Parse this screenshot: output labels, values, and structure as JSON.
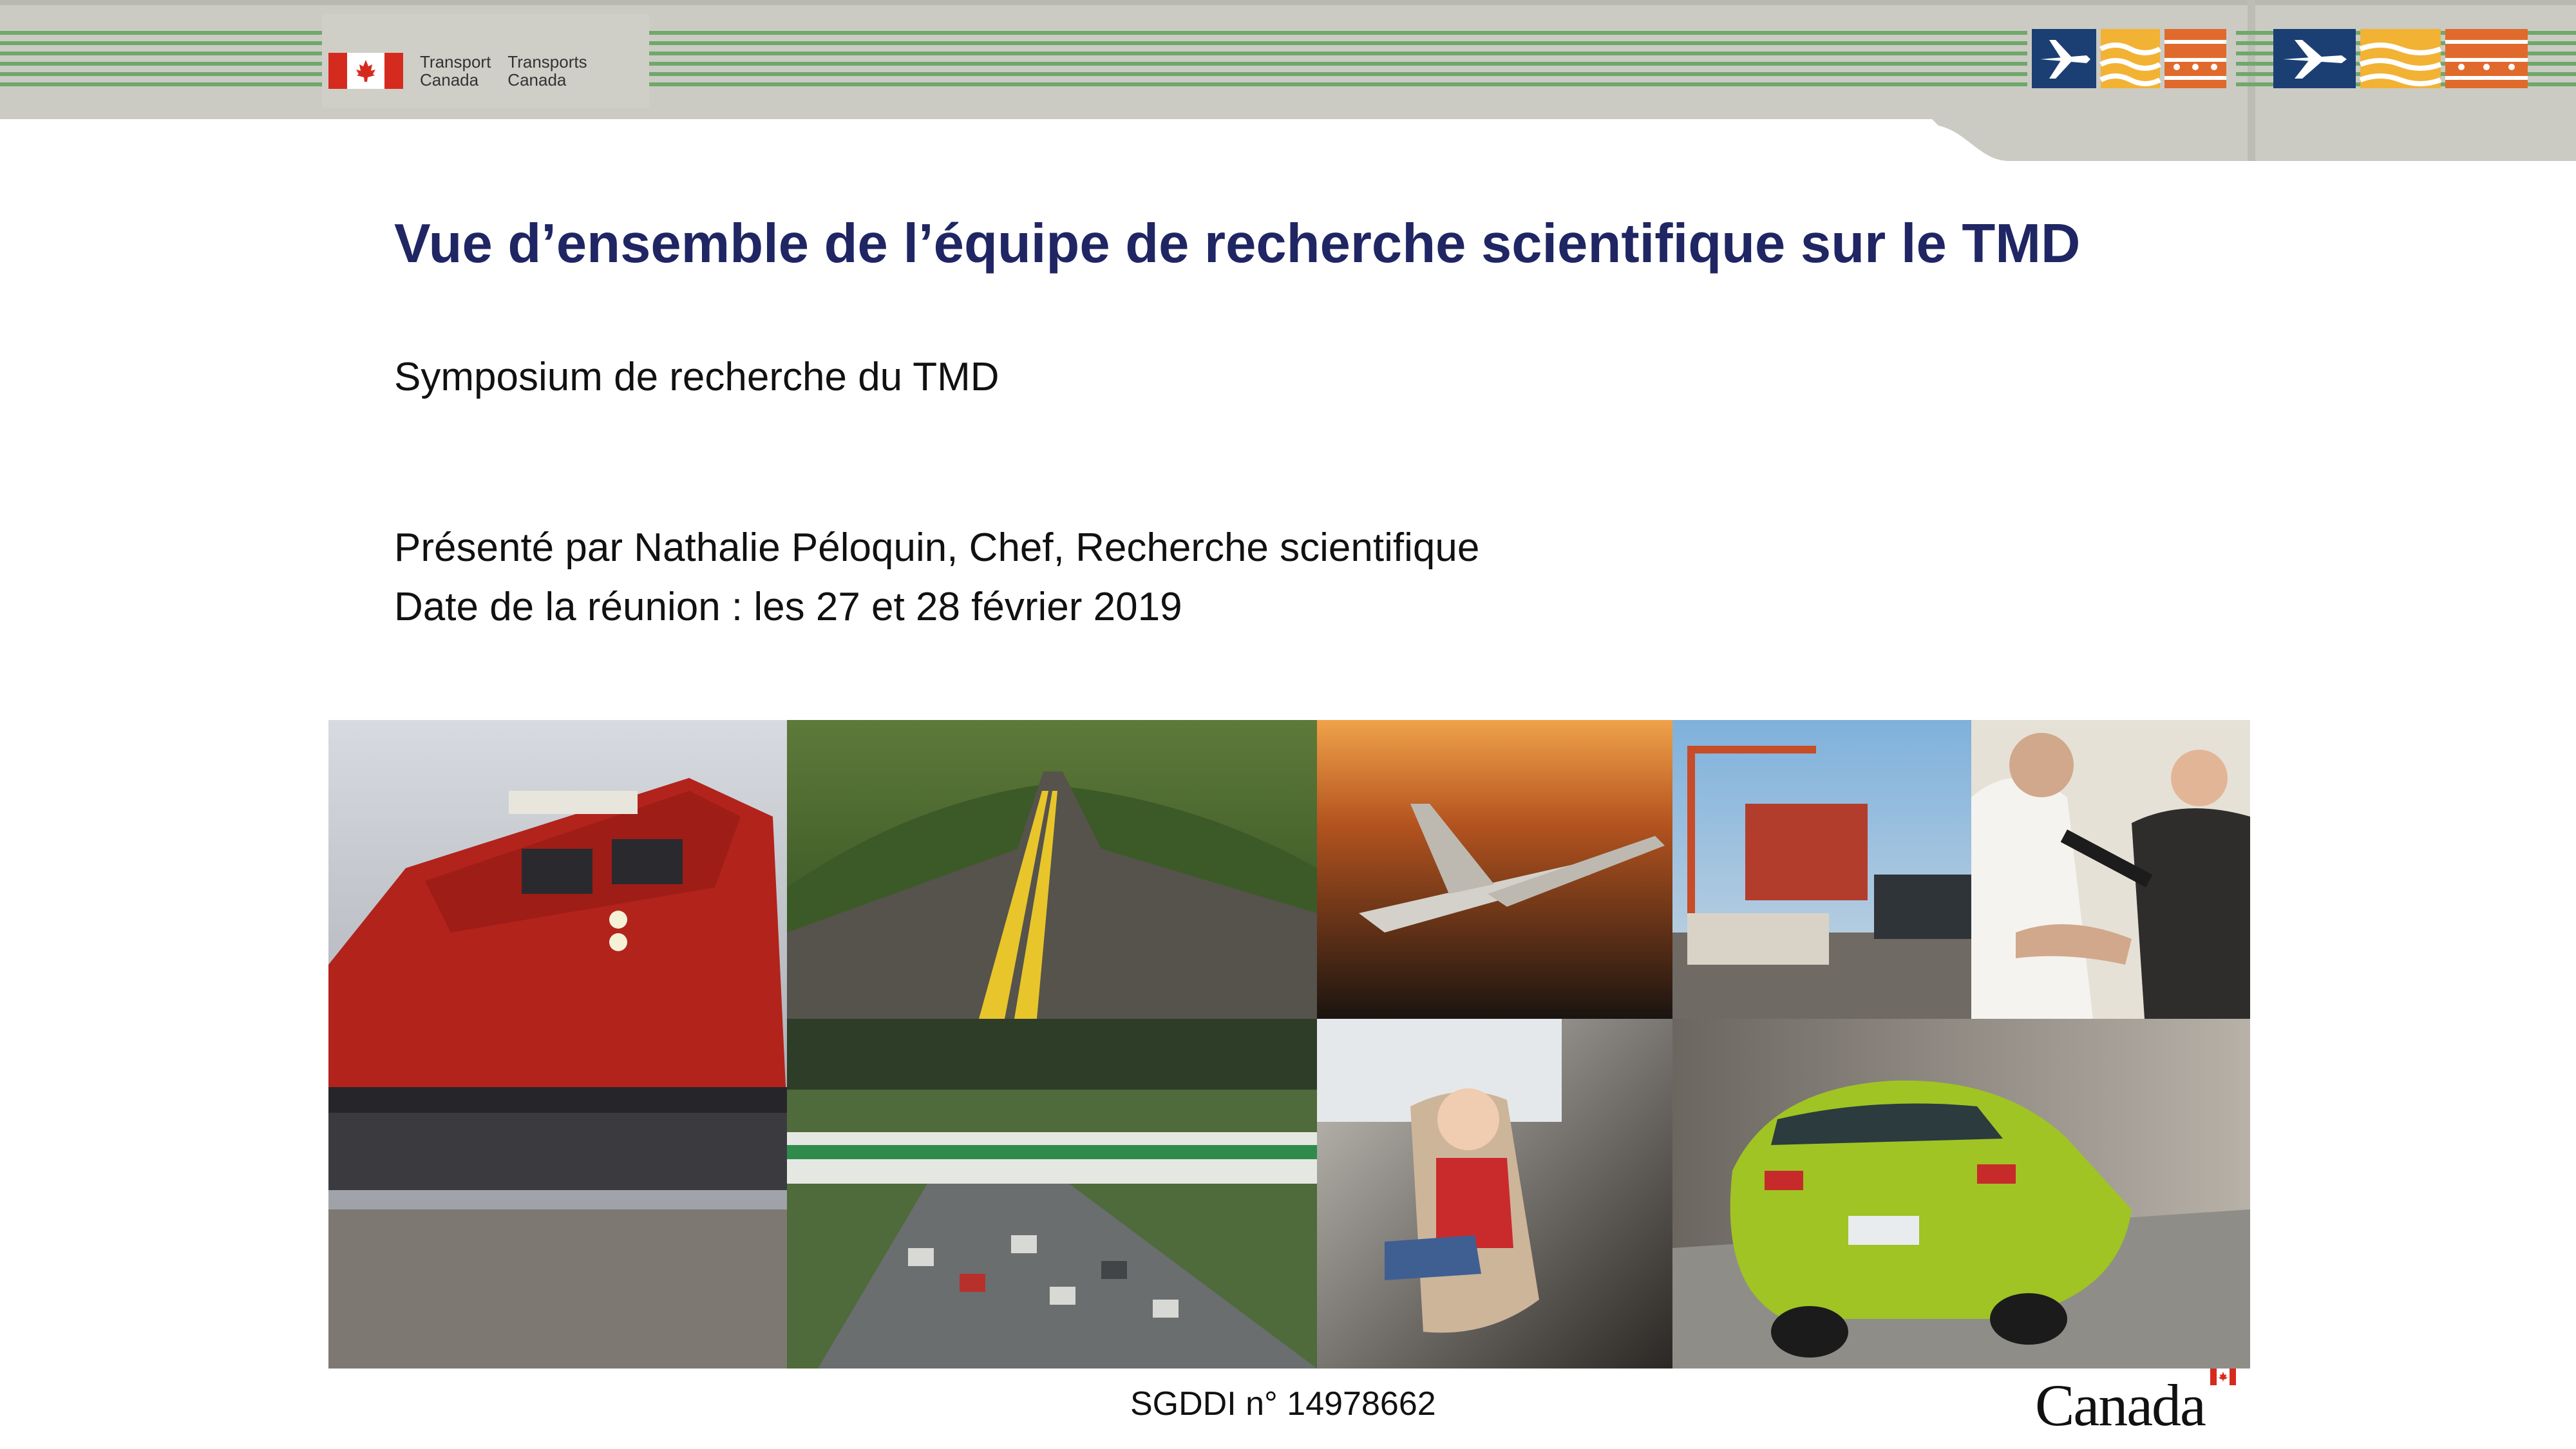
{
  "header": {
    "department_en_line1": "Transport",
    "department_en_line2": "Canada",
    "department_fr_line1": "Transports",
    "department_fr_line2": "Canada",
    "colors": {
      "band": "#cbcbc4",
      "stripe": "#6fa86a",
      "navy": "#1b3f73",
      "yellow": "#f2b234",
      "orange": "#e06a2c",
      "red": "#d52b1e"
    }
  },
  "slide": {
    "title": "Vue d’ensemble de l’équipe de recherche scientifique sur le TMD",
    "subtitle": "Symposium de recherche du TMD",
    "presenter": "Présenté par Nathalie Péloquin, Chef, Recherche scientifique",
    "meeting_date": "Date de la réunion : les 27 et 28 février 2019",
    "title_color": "#1f2663"
  },
  "collage": {
    "panels": [
      "train-photo",
      "highway-photo",
      "jet-photo",
      "container-port-photo",
      "security-screening-photo",
      "commuter-train-traffic-photo",
      "child-car-seat-photo",
      "green-car-photo"
    ]
  },
  "footer": {
    "document_id": "SGDDI n°   14978662",
    "wordmark": "Canada"
  }
}
